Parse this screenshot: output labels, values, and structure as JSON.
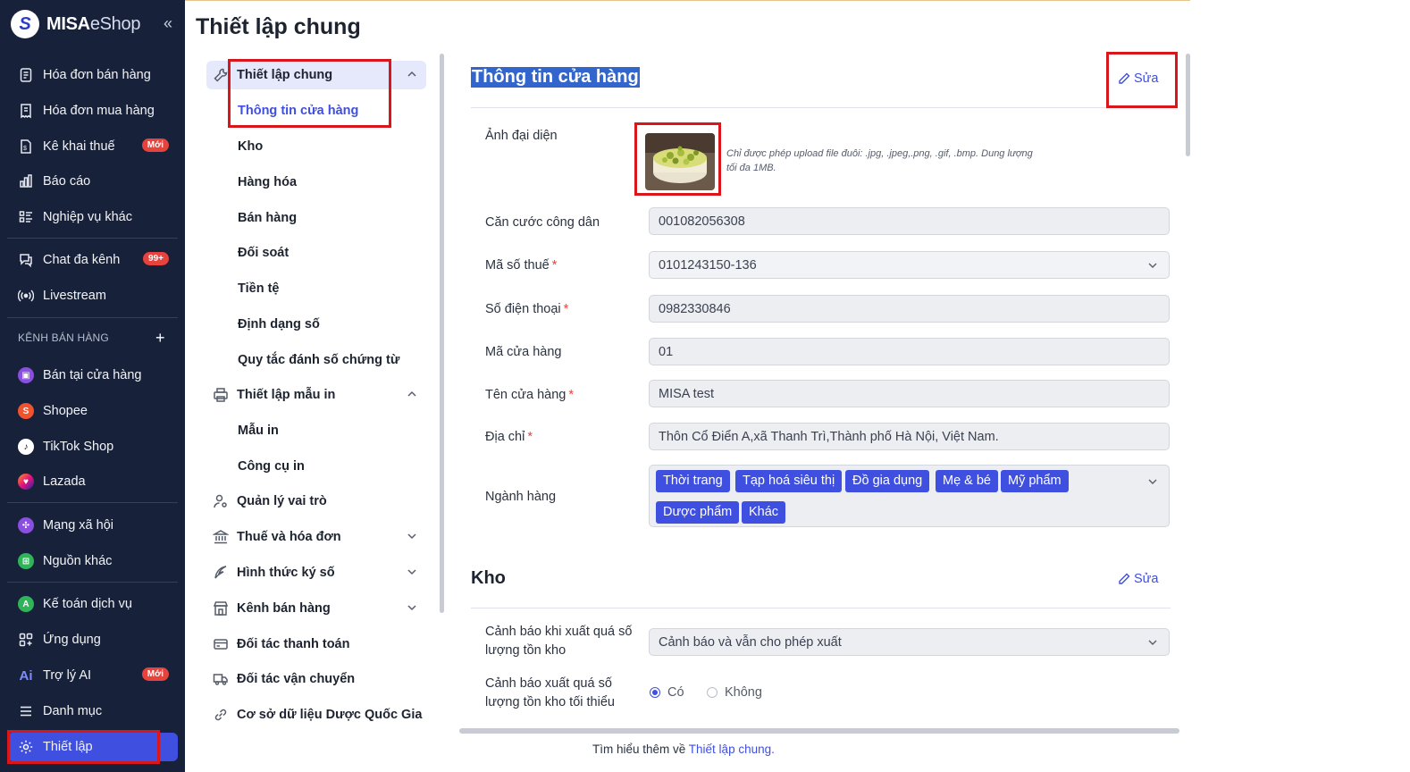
{
  "brand": {
    "logo_letter": "S",
    "name_bold": "MISA",
    "name_light": "eShop"
  },
  "sidebar": {
    "items": [
      {
        "label": "Hóa đơn bán hàng"
      },
      {
        "label": "Hóa đơn mua hàng"
      },
      {
        "label": "Kê khai thuế",
        "badge": "Mới"
      },
      {
        "label": "Báo cáo"
      },
      {
        "label": "Nghiệp vụ khác"
      },
      {
        "label": "Chat đa kênh",
        "badge": "99+"
      },
      {
        "label": "Livestream"
      },
      {
        "label": "Bán tại cửa hàng"
      },
      {
        "label": "Shopee"
      },
      {
        "label": "TikTok Shop"
      },
      {
        "label": "Lazada"
      },
      {
        "label": "Mạng xã hội"
      },
      {
        "label": "Nguồn khác"
      },
      {
        "label": "Kế toán dịch vụ"
      },
      {
        "label": "Ứng dụng"
      },
      {
        "label": "Trợ lý AI",
        "badge": "Mới",
        "icon_text": "Ai"
      },
      {
        "label": "Danh mục"
      },
      {
        "label": "Thiết lập"
      }
    ],
    "section_label": "KÊNH BÁN HÀNG",
    "section_plus": "+"
  },
  "page": {
    "title": "Thiết lập chung"
  },
  "menu": {
    "groups": [
      {
        "label": "Thiết lập chung"
      },
      {
        "label": "Thiết lập mẫu in"
      },
      {
        "label": "Quản lý vai trò"
      },
      {
        "label": "Thuế và hóa đơn"
      },
      {
        "label": "Hình thức ký số"
      },
      {
        "label": "Kênh bán hàng"
      },
      {
        "label": "Đối tác thanh toán"
      },
      {
        "label": "Đối tác vận chuyển"
      },
      {
        "label": "Cơ sở dữ liệu Dược Quốc Gia"
      }
    ],
    "sub_general": [
      "Thông tin cửa hàng",
      "Kho",
      "Hàng hóa",
      "Bán hàng",
      "Đối soát",
      "Tiền tệ",
      "Định dạng số",
      "Quy tắc đánh số chứng từ"
    ],
    "sub_print": [
      "Mẫu in",
      "Công cụ in"
    ]
  },
  "store": {
    "title": "Thông tin cửa hàng",
    "edit_label": "Sửa",
    "avatar_label": "Ảnh đại diện",
    "upload_hint": "Chỉ được phép upload file đuôi: .jpg, .jpeg,.png, .gif, .bmp. Dung lượng tối đa 1MB.",
    "fields": [
      {
        "label": "Căn cước công dân",
        "value": "001082056308"
      },
      {
        "label": "Mã số thuế",
        "value": "0101243150-136",
        "required": "*"
      },
      {
        "label": "Số điện thoại",
        "value": "0982330846",
        "required": "*"
      },
      {
        "label": "Mã cửa hàng",
        "value": "01"
      },
      {
        "label": "Tên cửa hàng",
        "value": "MISA test",
        "required": "*"
      },
      {
        "label": "Địa chỉ",
        "value": "Thôn Cổ Điển A,xã Thanh Trì,Thành phố Hà Nội, Việt Nam.",
        "required": "*"
      }
    ],
    "industry_label": "Ngành hàng",
    "industries": [
      "Thời trang",
      "Tạp hoá siêu thị",
      "Đồ gia dụng",
      "Mẹ & bé",
      "Mỹ phẩm",
      "Dược phẩm",
      "Khác"
    ]
  },
  "warehouse": {
    "title": "Kho",
    "edit_label": "Sửa",
    "warn_label_1": "Cảnh báo khi xuất quá số",
    "warn_label_2": "lượng tồn kho",
    "warn_value": "Cảnh báo và vẫn cho phép xuất",
    "min_label_1": "Cảnh báo xuất quá số",
    "min_label_2": "lượng tồn kho tối thiểu",
    "option_yes": "Có",
    "option_no": "Không"
  },
  "footer": {
    "text": "Tìm hiểu thêm về ",
    "link": "Thiết lập chung."
  },
  "colors": {
    "accent": "#3f4fe0",
    "sidebar_bg": "#17223a",
    "highlight": "#d9161c"
  }
}
